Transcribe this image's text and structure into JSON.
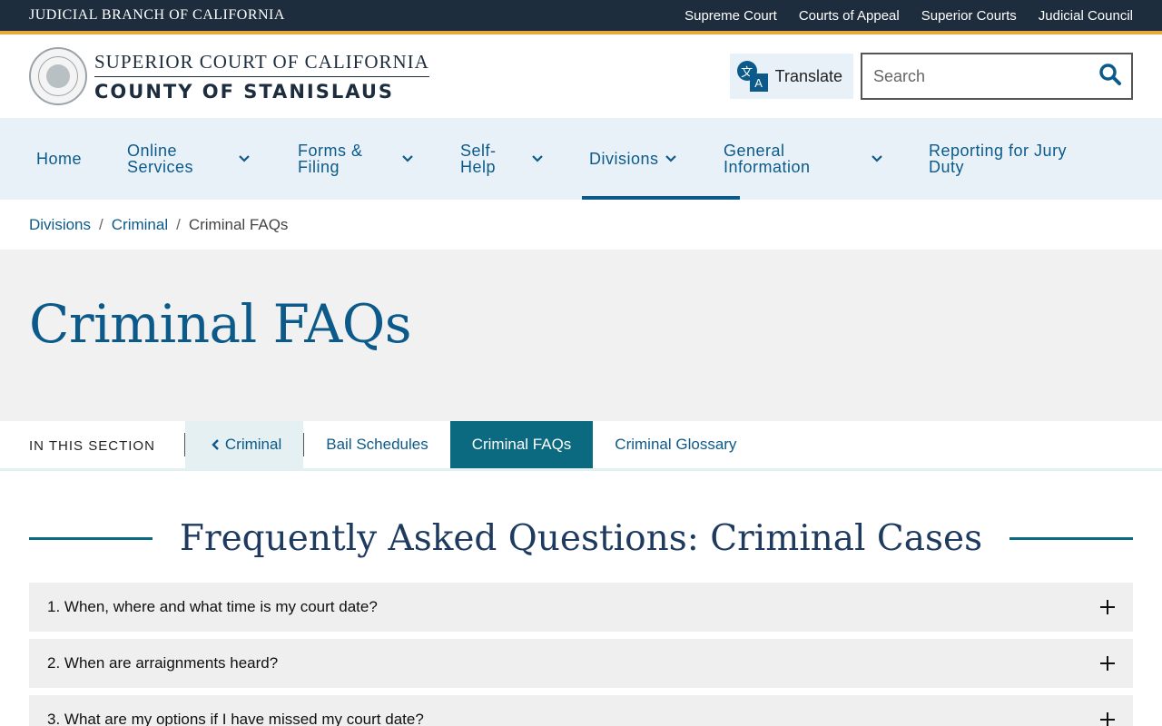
{
  "topbar": {
    "brand": "JUDICIAL BRANCH OF CALIFORNIA",
    "links": [
      "Supreme Court",
      "Courts of Appeal",
      "Superior Courts",
      "Judicial Council"
    ]
  },
  "header": {
    "logo_line1": "SUPERIOR COURT OF CALIFORNIA",
    "logo_line2": "COUNTY OF STANISLAUS",
    "translate_label": "Translate",
    "translate_glyph_1": "文",
    "translate_glyph_2": "A",
    "search_placeholder": "Search",
    "search_value": ""
  },
  "nav": {
    "items": [
      {
        "label": "Home",
        "dropdown": false
      },
      {
        "label": "Online Services",
        "dropdown": true
      },
      {
        "label": "Forms & Filing",
        "dropdown": true
      },
      {
        "label": "Self-Help",
        "dropdown": true
      },
      {
        "label": "Divisions",
        "dropdown": true,
        "active": true
      },
      {
        "label": "General Information",
        "dropdown": true
      },
      {
        "label": "Reporting for Jury Duty",
        "dropdown": false
      }
    ]
  },
  "breadcrumb": {
    "items": [
      "Divisions",
      "Criminal"
    ],
    "current": "Criminal FAQs",
    "separator": "/"
  },
  "hero": {
    "title": "Criminal FAQs"
  },
  "section_nav": {
    "label": "IN THIS SECTION",
    "back": "Criminal",
    "tabs": [
      "Bail Schedules",
      "Criminal FAQs",
      "Criminal Glossary"
    ],
    "current": "Criminal FAQs"
  },
  "faq": {
    "title": "Frequently Asked Questions: Criminal Cases",
    "questions": [
      "1. When, where and what time is my court date?",
      "2. When are arraignments heard?",
      "3. What are my options if I have missed my court date?"
    ]
  },
  "colors": {
    "topbar": "#1e2d3d",
    "accent_gold": "#e8a93a",
    "brand_blue": "#0c5a8a",
    "teal": "#0b6a7f",
    "nav_bg": "#e9f1f8"
  }
}
